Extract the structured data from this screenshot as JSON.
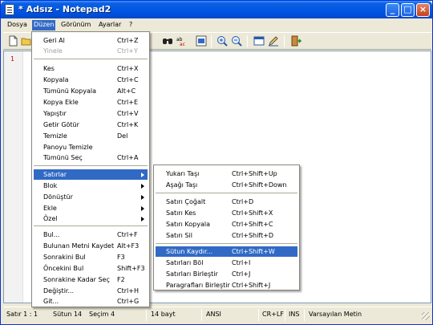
{
  "window": {
    "title": "* Adsız - Notepad2",
    "minimize": "_",
    "maximize": "□",
    "close": "×"
  },
  "menubar": [
    "Dosya",
    "Düzen",
    "Görünüm",
    "Ayarlar",
    "?"
  ],
  "toolbar_icons": [
    "new-file-icon",
    "open-folder-icon",
    "find-icon",
    "replace-icon",
    "select-all-icon",
    "zoom-in-icon",
    "zoom-out-icon",
    "settings-icon",
    "edit-icon",
    "exit-icon"
  ],
  "editor": {
    "line_number": "1"
  },
  "edit_menu": {
    "items": [
      {
        "label": "Geri Al",
        "shortcut": "Ctrl+Z",
        "disabled": false
      },
      {
        "label": "Yinele",
        "shortcut": "Ctrl+Y",
        "disabled": true
      },
      {
        "label": "Kes",
        "shortcut": "Ctrl+X",
        "disabled": false
      },
      {
        "label": "Kopyala",
        "shortcut": "Ctrl+C",
        "disabled": false
      },
      {
        "label": "Tümünü Kopyala",
        "shortcut": "Alt+C",
        "disabled": false
      },
      {
        "label": "Kopya Ekle",
        "shortcut": "Ctrl+E",
        "disabled": false
      },
      {
        "label": "Yapıştır",
        "shortcut": "Ctrl+V",
        "disabled": false
      },
      {
        "label": "Getir Götür",
        "shortcut": "Ctrl+K",
        "disabled": false
      },
      {
        "label": "Temizle",
        "shortcut": "Del",
        "disabled": false
      },
      {
        "label": "Panoyu Temizle",
        "shortcut": "",
        "disabled": false
      },
      {
        "label": "Tümünü Seç",
        "shortcut": "Ctrl+A",
        "disabled": false
      },
      {
        "label": "Satırlar",
        "shortcut": "",
        "submenu": true,
        "highlighted": true
      },
      {
        "label": "Blok",
        "shortcut": "",
        "submenu": true
      },
      {
        "label": "Dönüştür",
        "shortcut": "",
        "submenu": true
      },
      {
        "label": "Ekle",
        "shortcut": "",
        "submenu": true
      },
      {
        "label": "Özel",
        "shortcut": "",
        "submenu": true
      },
      {
        "label": "Bul...",
        "shortcut": "Ctrl+F",
        "disabled": false
      },
      {
        "label": "Bulunan Metni Kaydet",
        "shortcut": "Alt+F3",
        "disabled": false
      },
      {
        "label": "Sonrakini Bul",
        "shortcut": "F3",
        "disabled": false
      },
      {
        "label": "Öncekini Bul",
        "shortcut": "Shift+F3",
        "disabled": false
      },
      {
        "label": "Sonrakine Kadar Seç",
        "shortcut": "F2",
        "disabled": false
      },
      {
        "label": "Değiştir...",
        "shortcut": "Ctrl+H",
        "disabled": false
      },
      {
        "label": "Git...",
        "shortcut": "Ctrl+G",
        "disabled": false
      }
    ]
  },
  "lines_menu": {
    "items": [
      {
        "label": "Yukarı Taşı",
        "shortcut": "Ctrl+Shift+Up"
      },
      {
        "label": "Aşağı Taşı",
        "shortcut": "Ctrl+Shift+Down"
      },
      {
        "label": "Satırı Çoğalt",
        "shortcut": "Ctrl+D"
      },
      {
        "label": "Satırı Kes",
        "shortcut": "Ctrl+Shift+X"
      },
      {
        "label": "Satırı Kopyala",
        "shortcut": "Ctrl+Shift+C"
      },
      {
        "label": "Satırı Sil",
        "shortcut": "Ctrl+Shift+D"
      },
      {
        "label": "Sütun Kaydır...",
        "shortcut": "Ctrl+Shift+W",
        "highlighted": true
      },
      {
        "label": "Satırları Böl",
        "shortcut": "Ctrl+I"
      },
      {
        "label": "Satırları Birleştir",
        "shortcut": "Ctrl+J"
      },
      {
        "label": "Paragrafları Birleştir",
        "shortcut": "Ctrl+Shift+J"
      }
    ]
  },
  "statusbar": {
    "position": "Satır 1 : 1",
    "column": "Sütun 14",
    "selection": "Seçim 4",
    "size": "14 bayt",
    "encoding": "ANSI",
    "line_ending": "CR+LF",
    "insert_mode": "INS",
    "scheme": "Varsayılan Metin"
  }
}
